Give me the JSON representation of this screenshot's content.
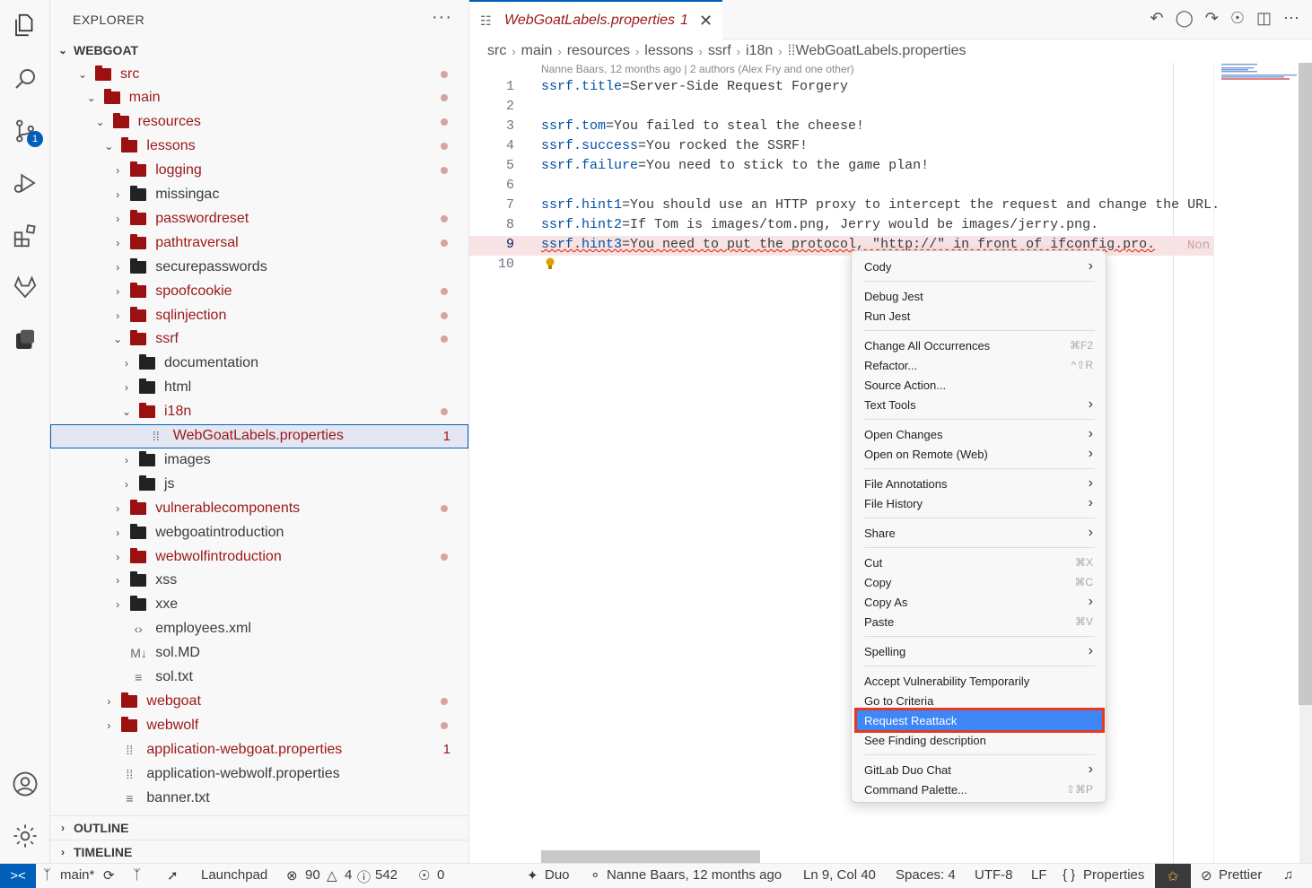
{
  "sidebar": {
    "title": "EXPLORER",
    "more_label": "···",
    "root": "WEBGOAT",
    "outline": "OUTLINE",
    "timeline": "TIMELINE",
    "tree": [
      {
        "label": "src",
        "kind": "folder",
        "open": true,
        "modified": true,
        "indent": 0
      },
      {
        "label": "main",
        "kind": "folder",
        "open": true,
        "modified": true,
        "indent": 1
      },
      {
        "label": "resources",
        "kind": "folder",
        "open": true,
        "modified": true,
        "indent": 2
      },
      {
        "label": "lessons",
        "kind": "folder",
        "open": true,
        "modified": true,
        "indent": 3
      },
      {
        "label": "logging",
        "kind": "folder",
        "open": false,
        "modified": true,
        "indent": 4
      },
      {
        "label": "missingac",
        "kind": "folder",
        "open": false,
        "modified": false,
        "indent": 4
      },
      {
        "label": "passwordreset",
        "kind": "folder",
        "open": false,
        "modified": true,
        "indent": 4
      },
      {
        "label": "pathtraversal",
        "kind": "folder",
        "open": false,
        "modified": true,
        "indent": 4
      },
      {
        "label": "securepasswords",
        "kind": "folder",
        "open": false,
        "modified": false,
        "indent": 4
      },
      {
        "label": "spoofcookie",
        "kind": "folder",
        "open": false,
        "modified": true,
        "indent": 4
      },
      {
        "label": "sqlinjection",
        "kind": "folder",
        "open": false,
        "modified": true,
        "indent": 4
      },
      {
        "label": "ssrf",
        "kind": "folder",
        "open": true,
        "modified": true,
        "indent": 4
      },
      {
        "label": "documentation",
        "kind": "folder",
        "open": false,
        "modified": false,
        "indent": 5
      },
      {
        "label": "html",
        "kind": "folder",
        "open": false,
        "modified": false,
        "indent": 5
      },
      {
        "label": "i18n",
        "kind": "folder",
        "open": true,
        "modified": true,
        "indent": 5
      },
      {
        "label": "WebGoatLabels.properties",
        "kind": "props",
        "modified": true,
        "count": "1",
        "selected": true,
        "indent": 6
      },
      {
        "label": "images",
        "kind": "folder",
        "open": false,
        "modified": false,
        "indent": 5
      },
      {
        "label": "js",
        "kind": "folder",
        "open": false,
        "modified": false,
        "indent": 5
      },
      {
        "label": "vulnerablecomponents",
        "kind": "folder",
        "open": false,
        "modified": true,
        "indent": 4
      },
      {
        "label": "webgoatintroduction",
        "kind": "folder",
        "open": false,
        "modified": false,
        "indent": 4
      },
      {
        "label": "webwolfintroduction",
        "kind": "folder",
        "open": false,
        "modified": true,
        "indent": 4
      },
      {
        "label": "xss",
        "kind": "folder",
        "open": false,
        "modified": false,
        "indent": 4
      },
      {
        "label": "xxe",
        "kind": "folder",
        "open": false,
        "modified": false,
        "indent": 4
      },
      {
        "label": "employees.xml",
        "kind": "xml",
        "modified": false,
        "indent": 4
      },
      {
        "label": "sol.MD",
        "kind": "md",
        "modified": false,
        "indent": 4
      },
      {
        "label": "sol.txt",
        "kind": "txt",
        "modified": false,
        "indent": 4
      },
      {
        "label": "webgoat",
        "kind": "folder",
        "open": false,
        "modified": true,
        "indent": 3
      },
      {
        "label": "webwolf",
        "kind": "folder",
        "open": false,
        "modified": true,
        "indent": 3
      },
      {
        "label": "application-webgoat.properties",
        "kind": "props",
        "modified": true,
        "count": "1",
        "indent": 3
      },
      {
        "label": "application-webwolf.properties",
        "kind": "props",
        "modified": false,
        "indent": 3
      },
      {
        "label": "banner.txt",
        "kind": "txt",
        "modified": false,
        "indent": 3
      }
    ]
  },
  "activity": {
    "scm_badge": "1"
  },
  "editor": {
    "tab": {
      "label": "WebGoatLabels.properties",
      "count": "1",
      "close": "✕"
    },
    "breadcrumbs": [
      "src",
      "main",
      "resources",
      "lessons",
      "ssrf",
      "i18n",
      "WebGoatLabels.properties"
    ],
    "blame": "Nanne Baars, 12 months ago | 2 authors (Alex Fry and one other)",
    "lines": [
      {
        "n": "1",
        "key": "ssrf.title",
        "val": "=Server-Side Request Forgery"
      },
      {
        "n": "2",
        "key": "",
        "val": ""
      },
      {
        "n": "3",
        "key": "ssrf.tom",
        "val": "=You failed to steal the cheese!"
      },
      {
        "n": "4",
        "key": "ssrf.success",
        "val": "=You rocked the SSRF!"
      },
      {
        "n": "5",
        "key": "ssrf.failure",
        "val": "=You need to stick to the game plan!"
      },
      {
        "n": "6",
        "key": "",
        "val": ""
      },
      {
        "n": "7",
        "key": "ssrf.hint1",
        "val": "=You should use an HTTP proxy to intercept the request and change the URL."
      },
      {
        "n": "8",
        "key": "ssrf.hint2",
        "val": "=If Tom is images/tom.png, Jerry would be images/jerry.png."
      },
      {
        "n": "9",
        "key": "ssrf.hint3",
        "val": "=You need to put the protocol, \"http://\" in front of ifconfig.pro."
      },
      {
        "n": "10",
        "key": "",
        "val": ""
      }
    ],
    "inline_error": "Non"
  },
  "menu": {
    "items": [
      {
        "label": "Cody",
        "arrow": true,
        "group": 0
      },
      {
        "label": "Debug Jest",
        "group": 1
      },
      {
        "label": "Run Jest",
        "group": 1
      },
      {
        "label": "Change All Occurrences",
        "shortcut": "⌘F2",
        "group": 2
      },
      {
        "label": "Refactor...",
        "shortcut": "^⇧R",
        "group": 2
      },
      {
        "label": "Source Action...",
        "group": 2
      },
      {
        "label": "Text Tools",
        "arrow": true,
        "group": 2
      },
      {
        "label": "Open Changes",
        "arrow": true,
        "group": 3
      },
      {
        "label": "Open on Remote (Web)",
        "arrow": true,
        "group": 3
      },
      {
        "label": "File Annotations",
        "arrow": true,
        "group": 4
      },
      {
        "label": "File History",
        "arrow": true,
        "group": 4
      },
      {
        "label": "Share",
        "arrow": true,
        "group": 5
      },
      {
        "label": "Cut",
        "shortcut": "⌘X",
        "group": 6
      },
      {
        "label": "Copy",
        "shortcut": "⌘C",
        "group": 6
      },
      {
        "label": "Copy As",
        "arrow": true,
        "group": 6
      },
      {
        "label": "Paste",
        "shortcut": "⌘V",
        "group": 6
      },
      {
        "label": "Spelling",
        "arrow": true,
        "group": 7
      },
      {
        "label": "Accept Vulnerability Temporarily",
        "group": 8
      },
      {
        "label": "Go to Criteria",
        "group": 8
      },
      {
        "label": "Request Reattack",
        "group": 8,
        "highlighted": true
      },
      {
        "label": "See Finding description",
        "group": 8
      },
      {
        "label": "GitLab Duo Chat",
        "arrow": true,
        "group": 9
      },
      {
        "label": "Command Palette...",
        "shortcut": "⇧⌘P",
        "group": 9
      }
    ]
  },
  "status": {
    "remote": "><",
    "branch": "main*",
    "launchpad": "Launchpad",
    "errors": "90",
    "warnings": "4",
    "infos": "542",
    "ports": "0",
    "duo": "Duo",
    "blame": "Nanne Baars, 12 months ago",
    "position": "Ln 9, Col 40",
    "spaces": "Spaces: 4",
    "encoding": "UTF-8",
    "eol": "LF",
    "language": "Properties",
    "prettier": "Prettier"
  }
}
